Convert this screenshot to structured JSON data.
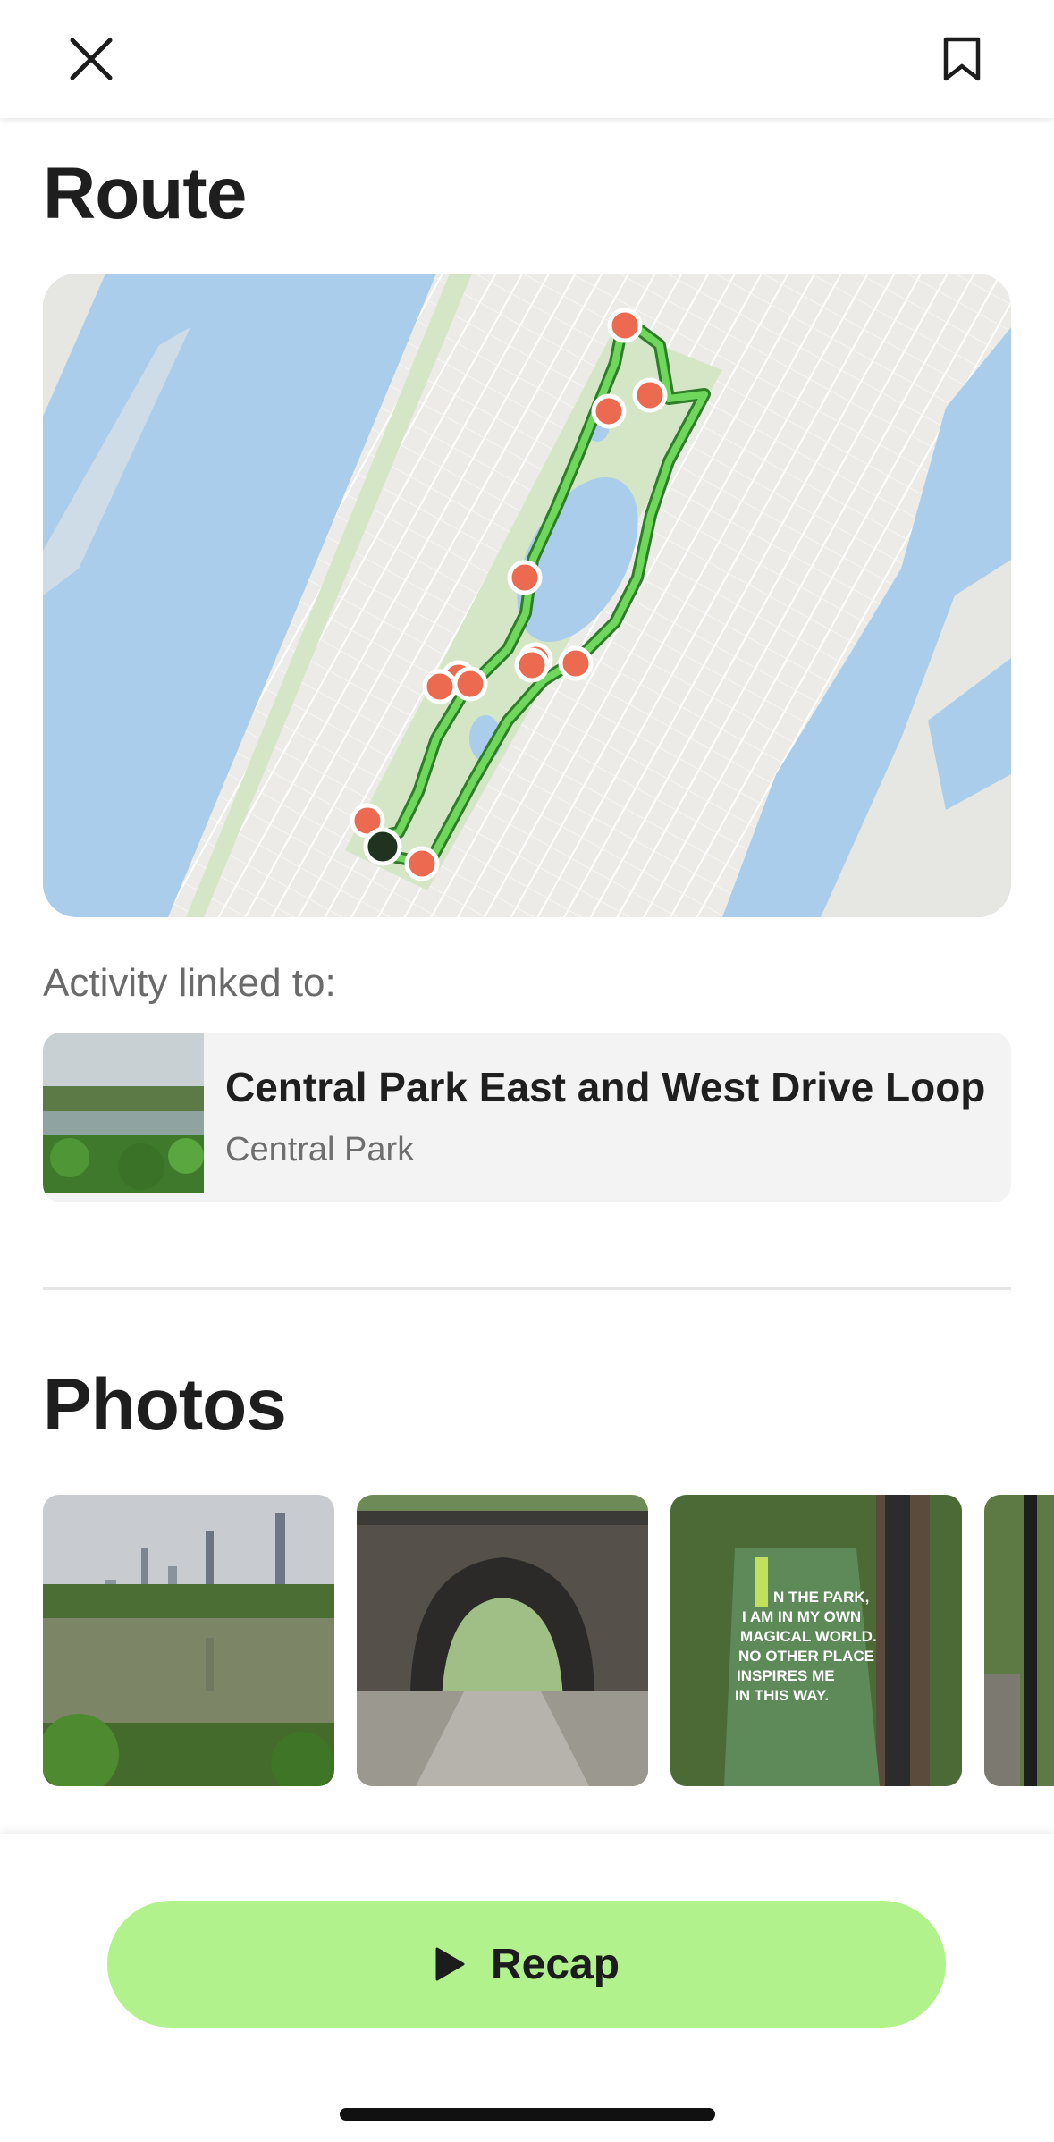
{
  "header": {
    "close_icon": "close-icon",
    "bookmark_icon": "bookmark-icon"
  },
  "route": {
    "title": "Route",
    "map": {
      "route_color": "#59c14a",
      "marker_color": "#ec6a50",
      "start_color": "#1f3320",
      "water_color": "#a9cdea",
      "park_color": "#d5e6c7"
    }
  },
  "activity": {
    "label": "Activity linked to:",
    "name": "Central Park East and West Drive Loop",
    "location": "Central Park"
  },
  "photos": {
    "title": "Photos",
    "items": [
      {
        "name": "lake-skyline-photo"
      },
      {
        "name": "stone-arch-bridge-photo"
      },
      {
        "name": "park-banner-photo",
        "text": "IN THE PARK, I AM IN MY OWN MAGICAL WORLD. NO OTHER PLACE INSPIRES ME IN THIS WAY."
      },
      {
        "name": "lamp-post-photo"
      }
    ]
  },
  "footer": {
    "recap_label": "Recap",
    "play_icon": "play-icon",
    "accent": "#b1f28c"
  }
}
